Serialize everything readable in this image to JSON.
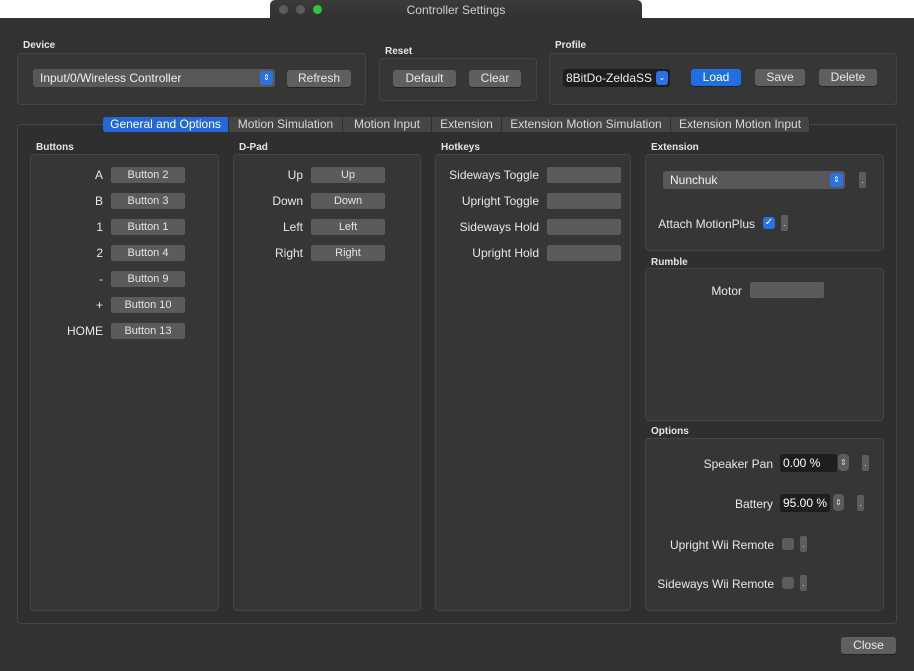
{
  "window": {
    "title": "Controller Settings"
  },
  "device": {
    "label": "Device",
    "selected": "Input/0/Wireless Controller",
    "refresh": "Refresh"
  },
  "reset": {
    "label": "Reset",
    "default": "Default",
    "clear": "Clear"
  },
  "profile": {
    "label": "Profile",
    "selected": "8BitDo-ZeldaSS",
    "load": "Load",
    "save": "Save",
    "delete": "Delete"
  },
  "tabs": [
    "General and Options",
    "Motion Simulation",
    "Motion Input",
    "Extension",
    "Extension Motion Simulation",
    "Extension Motion Input"
  ],
  "buttons": {
    "label": "Buttons",
    "rows": [
      {
        "name": "A",
        "value": "Button 2"
      },
      {
        "name": "B",
        "value": "Button 3"
      },
      {
        "name": "1",
        "value": "Button 1"
      },
      {
        "name": "2",
        "value": "Button 4"
      },
      {
        "name": "-",
        "value": "Button 9"
      },
      {
        "name": "+",
        "value": "Button 10"
      },
      {
        "name": "HOME",
        "value": "Button 13"
      }
    ]
  },
  "dpad": {
    "label": "D-Pad",
    "rows": [
      {
        "name": "Up",
        "value": "Up"
      },
      {
        "name": "Down",
        "value": "Down"
      },
      {
        "name": "Left",
        "value": "Left"
      },
      {
        "name": "Right",
        "value": "Right"
      }
    ]
  },
  "hotkeys": {
    "label": "Hotkeys",
    "rows": [
      {
        "name": "Sideways Toggle",
        "value": ""
      },
      {
        "name": "Upright Toggle",
        "value": ""
      },
      {
        "name": "Sideways Hold",
        "value": ""
      },
      {
        "name": "Upright Hold",
        "value": ""
      }
    ]
  },
  "extension": {
    "label": "Extension",
    "selected": "Nunchuk",
    "attach_label": "Attach MotionPlus",
    "attach_checked": true
  },
  "rumble": {
    "label": "Rumble",
    "motor_label": "Motor",
    "motor_value": ""
  },
  "options": {
    "label": "Options",
    "speaker_pan_label": "Speaker Pan",
    "speaker_pan": "0.00 %",
    "battery_label": "Battery",
    "battery": "95.00 %",
    "upright_label": "Upright Wii Remote",
    "sideways_label": "Sideways Wii Remote"
  },
  "footer": {
    "close": "Close"
  },
  "colors": {
    "accent": "#2468d8",
    "window_bg": "#323232"
  }
}
